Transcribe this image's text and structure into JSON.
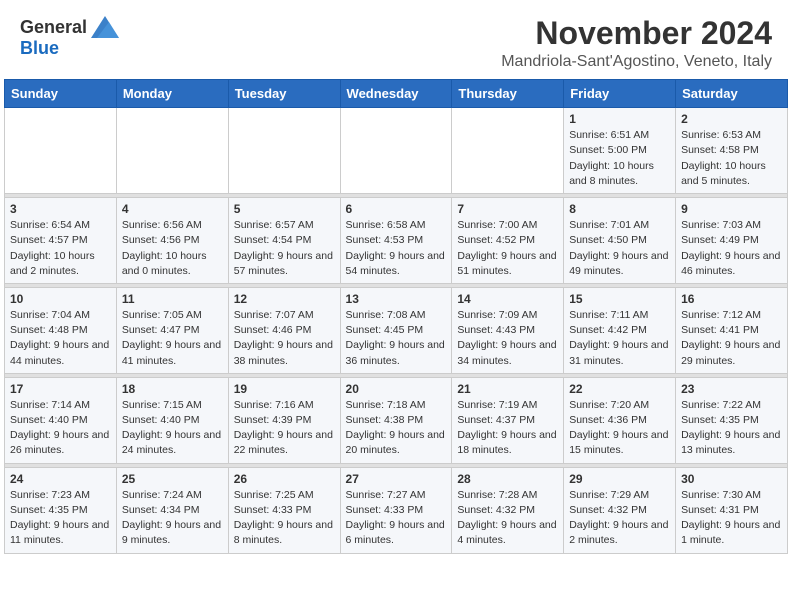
{
  "logo": {
    "general": "General",
    "blue": "Blue",
    "tagline": ""
  },
  "title": "November 2024",
  "subtitle": "Mandriola-Sant'Agostino, Veneto, Italy",
  "headers": [
    "Sunday",
    "Monday",
    "Tuesday",
    "Wednesday",
    "Thursday",
    "Friday",
    "Saturday"
  ],
  "weeks": [
    [
      {
        "day": "",
        "info": ""
      },
      {
        "day": "",
        "info": ""
      },
      {
        "day": "",
        "info": ""
      },
      {
        "day": "",
        "info": ""
      },
      {
        "day": "",
        "info": ""
      },
      {
        "day": "1",
        "info": "Sunrise: 6:51 AM\nSunset: 5:00 PM\nDaylight: 10 hours and 8 minutes."
      },
      {
        "day": "2",
        "info": "Sunrise: 6:53 AM\nSunset: 4:58 PM\nDaylight: 10 hours and 5 minutes."
      }
    ],
    [
      {
        "day": "3",
        "info": "Sunrise: 6:54 AM\nSunset: 4:57 PM\nDaylight: 10 hours and 2 minutes."
      },
      {
        "day": "4",
        "info": "Sunrise: 6:56 AM\nSunset: 4:56 PM\nDaylight: 10 hours and 0 minutes."
      },
      {
        "day": "5",
        "info": "Sunrise: 6:57 AM\nSunset: 4:54 PM\nDaylight: 9 hours and 57 minutes."
      },
      {
        "day": "6",
        "info": "Sunrise: 6:58 AM\nSunset: 4:53 PM\nDaylight: 9 hours and 54 minutes."
      },
      {
        "day": "7",
        "info": "Sunrise: 7:00 AM\nSunset: 4:52 PM\nDaylight: 9 hours and 51 minutes."
      },
      {
        "day": "8",
        "info": "Sunrise: 7:01 AM\nSunset: 4:50 PM\nDaylight: 9 hours and 49 minutes."
      },
      {
        "day": "9",
        "info": "Sunrise: 7:03 AM\nSunset: 4:49 PM\nDaylight: 9 hours and 46 minutes."
      }
    ],
    [
      {
        "day": "10",
        "info": "Sunrise: 7:04 AM\nSunset: 4:48 PM\nDaylight: 9 hours and 44 minutes."
      },
      {
        "day": "11",
        "info": "Sunrise: 7:05 AM\nSunset: 4:47 PM\nDaylight: 9 hours and 41 minutes."
      },
      {
        "day": "12",
        "info": "Sunrise: 7:07 AM\nSunset: 4:46 PM\nDaylight: 9 hours and 38 minutes."
      },
      {
        "day": "13",
        "info": "Sunrise: 7:08 AM\nSunset: 4:45 PM\nDaylight: 9 hours and 36 minutes."
      },
      {
        "day": "14",
        "info": "Sunrise: 7:09 AM\nSunset: 4:43 PM\nDaylight: 9 hours and 34 minutes."
      },
      {
        "day": "15",
        "info": "Sunrise: 7:11 AM\nSunset: 4:42 PM\nDaylight: 9 hours and 31 minutes."
      },
      {
        "day": "16",
        "info": "Sunrise: 7:12 AM\nSunset: 4:41 PM\nDaylight: 9 hours and 29 minutes."
      }
    ],
    [
      {
        "day": "17",
        "info": "Sunrise: 7:14 AM\nSunset: 4:40 PM\nDaylight: 9 hours and 26 minutes."
      },
      {
        "day": "18",
        "info": "Sunrise: 7:15 AM\nSunset: 4:40 PM\nDaylight: 9 hours and 24 minutes."
      },
      {
        "day": "19",
        "info": "Sunrise: 7:16 AM\nSunset: 4:39 PM\nDaylight: 9 hours and 22 minutes."
      },
      {
        "day": "20",
        "info": "Sunrise: 7:18 AM\nSunset: 4:38 PM\nDaylight: 9 hours and 20 minutes."
      },
      {
        "day": "21",
        "info": "Sunrise: 7:19 AM\nSunset: 4:37 PM\nDaylight: 9 hours and 18 minutes."
      },
      {
        "day": "22",
        "info": "Sunrise: 7:20 AM\nSunset: 4:36 PM\nDaylight: 9 hours and 15 minutes."
      },
      {
        "day": "23",
        "info": "Sunrise: 7:22 AM\nSunset: 4:35 PM\nDaylight: 9 hours and 13 minutes."
      }
    ],
    [
      {
        "day": "24",
        "info": "Sunrise: 7:23 AM\nSunset: 4:35 PM\nDaylight: 9 hours and 11 minutes."
      },
      {
        "day": "25",
        "info": "Sunrise: 7:24 AM\nSunset: 4:34 PM\nDaylight: 9 hours and 9 minutes."
      },
      {
        "day": "26",
        "info": "Sunrise: 7:25 AM\nSunset: 4:33 PM\nDaylight: 9 hours and 8 minutes."
      },
      {
        "day": "27",
        "info": "Sunrise: 7:27 AM\nSunset: 4:33 PM\nDaylight: 9 hours and 6 minutes."
      },
      {
        "day": "28",
        "info": "Sunrise: 7:28 AM\nSunset: 4:32 PM\nDaylight: 9 hours and 4 minutes."
      },
      {
        "day": "29",
        "info": "Sunrise: 7:29 AM\nSunset: 4:32 PM\nDaylight: 9 hours and 2 minutes."
      },
      {
        "day": "30",
        "info": "Sunrise: 7:30 AM\nSunset: 4:31 PM\nDaylight: 9 hours and 1 minute."
      }
    ]
  ]
}
